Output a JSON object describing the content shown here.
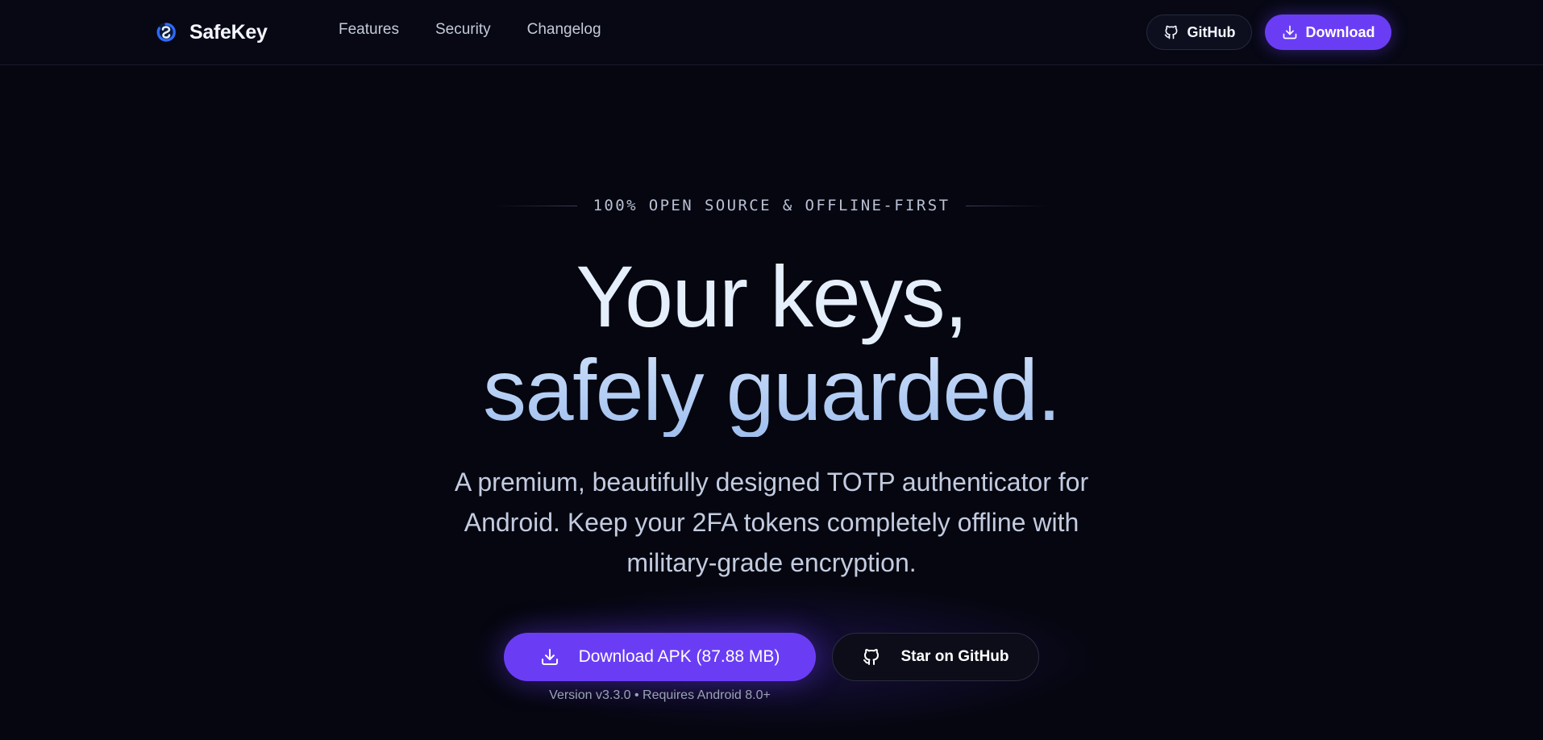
{
  "brand": {
    "name": "SafeKey",
    "logo_icon": "shield-key-icon",
    "accent": "#2f6bff"
  },
  "nav": {
    "links": [
      "Features",
      "Security",
      "Changelog"
    ],
    "github_label": "GitHub",
    "download_label": "Download"
  },
  "hero": {
    "eyebrow": "100% OPEN SOURCE & OFFLINE-FIRST",
    "headline_line1": "Your keys,",
    "headline_line2": "safely guarded.",
    "subtitle": "A premium, beautifully designed TOTP authenticator for Android. Keep your 2FA tokens completely offline with military-grade encryption."
  },
  "cta": {
    "primary_label": "Download APK (87.88 MB)",
    "secondary_label": "Star on GitHub",
    "version_note": "Version v3.3.0 • Requires Android 8.0+"
  },
  "colors": {
    "background": "#05060f",
    "primary": "#6a3df5",
    "text": "#e6eefc"
  }
}
